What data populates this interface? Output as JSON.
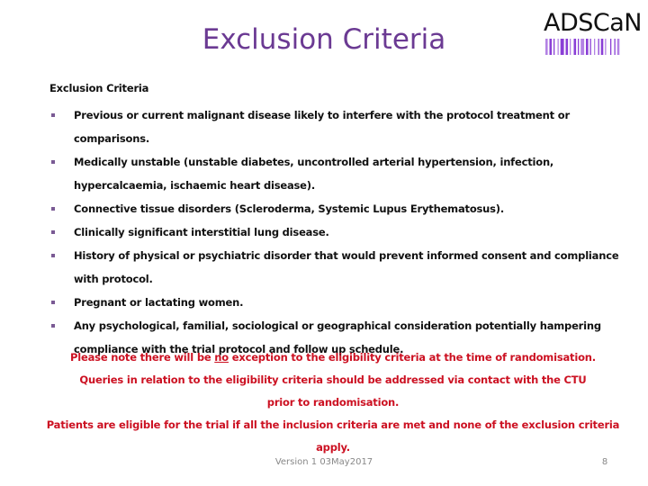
{
  "slide": {
    "title": "Exclusion Criteria",
    "logo": {
      "text": "ADSCaN",
      "bar_color": "#8a3fd6",
      "icon": "barcode-logo-icon"
    }
  },
  "content": {
    "heading": "Exclusion Criteria",
    "bullet_icon": "square-bullet-icon",
    "bullet_color": "#7a5a94",
    "items": [
      "Previous or current malignant disease likely to interfere with the protocol treatment or comparisons.",
      "Medically unstable (unstable diabetes, uncontrolled arterial hypertension, infection, hypercalcaemia, ischaemic heart disease).",
      "Connective tissue disorders (Scleroderma, Systemic Lupus Erythematosus).",
      "Clinically significant interstitial lung disease.",
      "History of physical or psychiatric disorder that would prevent informed consent and compliance with protocol.",
      "Pregnant or lactating women.",
      "Any psychological, familial, sociological or geographical consideration potentially hampering compliance with the trial protocol and follow up schedule."
    ]
  },
  "notes": {
    "color": "#cc1122",
    "line1_before": "Please note there will be ",
    "line1_underlined": "no",
    "line1_after": " exception to the eligibility criteria at the time of randomisation.",
    "line2": "Queries in relation to the eligibility criteria should be addressed via contact with the CTU prior to randomisation.",
    "line3": "Patients are eligible for the trial if all the inclusion criteria are met and none of the exclusion criteria apply."
  },
  "footer": {
    "version": "Version 1 03May2017",
    "page_number": "8"
  }
}
